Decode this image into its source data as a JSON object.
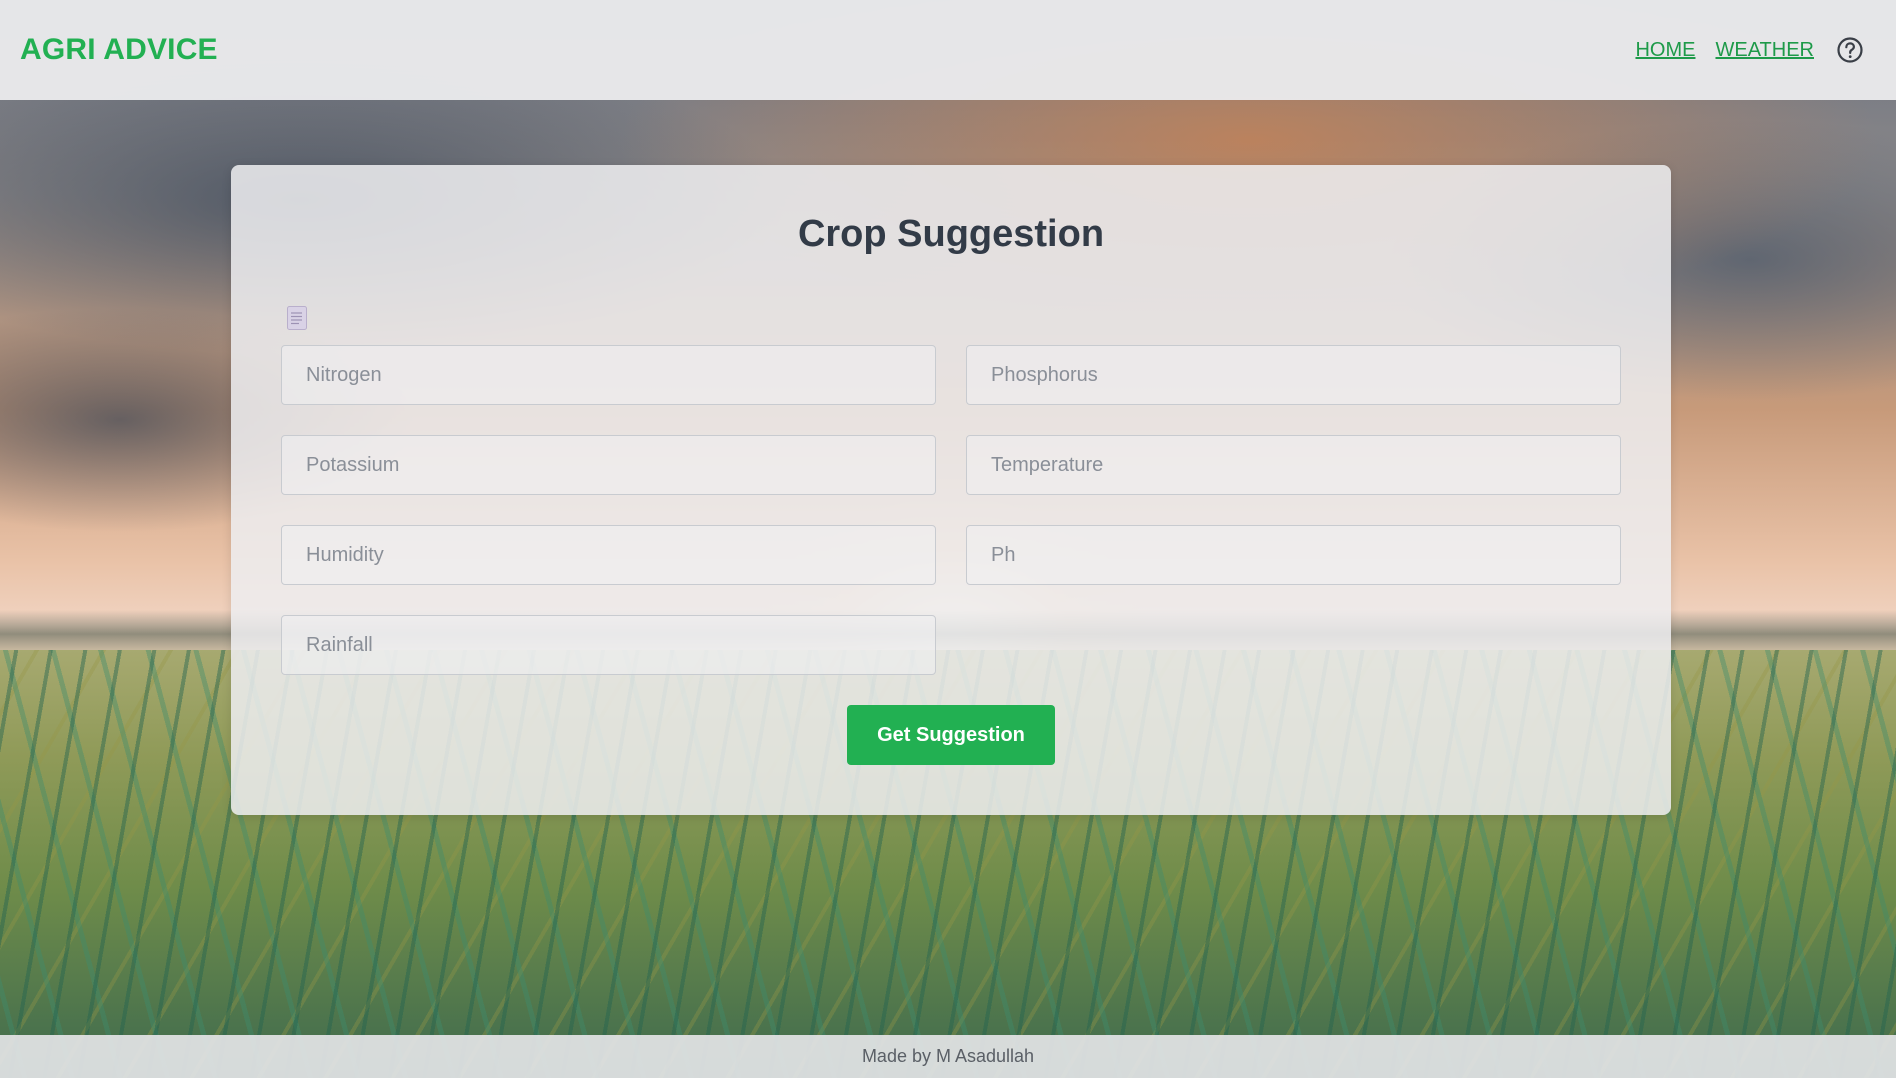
{
  "header": {
    "brand": "AGRI ADVICE",
    "nav": {
      "home": "HOME",
      "weather": "WEATHER",
      "help_icon": "question-circle-icon"
    }
  },
  "form": {
    "title": "Crop Suggestion",
    "doc_icon": "document-icon",
    "fields": {
      "nitrogen": {
        "placeholder": "Nitrogen",
        "value": ""
      },
      "phosphorus": {
        "placeholder": "Phosphorus",
        "value": ""
      },
      "potassium": {
        "placeholder": "Potassium",
        "value": ""
      },
      "temperature": {
        "placeholder": "Temperature",
        "value": ""
      },
      "humidity": {
        "placeholder": "Humidity",
        "value": ""
      },
      "ph": {
        "placeholder": "Ph",
        "value": ""
      },
      "rainfall": {
        "placeholder": "Rainfall",
        "value": ""
      }
    },
    "submit_label": "Get Suggestion"
  },
  "footer": {
    "text": "Made by M Asadullah"
  },
  "colors": {
    "brand": "#22b052",
    "link": "#1e9a49",
    "button": "#22b052",
    "title": "#323b47"
  }
}
